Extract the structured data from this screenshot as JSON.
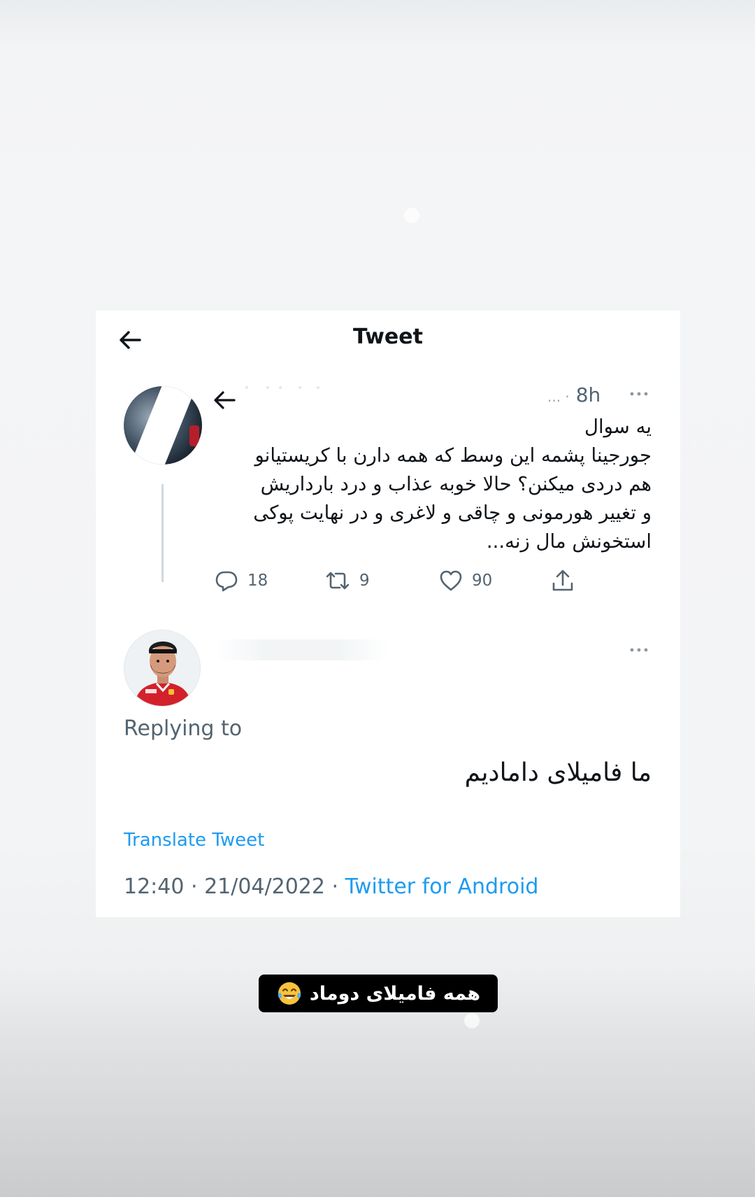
{
  "header": {
    "title": "Tweet"
  },
  "original_tweet": {
    "time": "8h",
    "time_prefix": "... ·",
    "text_lines": [
      "یه سوال",
      "جورجینا پشمه این وسط که همه دارن با کریستیانو",
      "هم دردی میکنن؟ حالا خوبه عذاب و درد بارداریش",
      "و تغییر هورمونی و چاقی و لاغری و در نهایت پوکی",
      "استخونش مال زنه..."
    ],
    "counts": {
      "replies": "18",
      "retweets": "9",
      "likes": "90"
    }
  },
  "reply_tweet": {
    "replying_to_label": "Replying to",
    "text": "ما فامیلای دامادیم",
    "translate_label": "Translate Tweet",
    "timestamp": "12:40 · 21/04/2022 ·",
    "source": "Twitter for Android"
  },
  "caption": {
    "text": "همه فامیلای دوماد",
    "emoji_icon": "face-with-tears-of-joy-icon"
  },
  "colors": {
    "text_primary": "#0f1419",
    "text_secondary": "#536471",
    "link": "#1d9bf0",
    "caption_bg": "#000000"
  }
}
